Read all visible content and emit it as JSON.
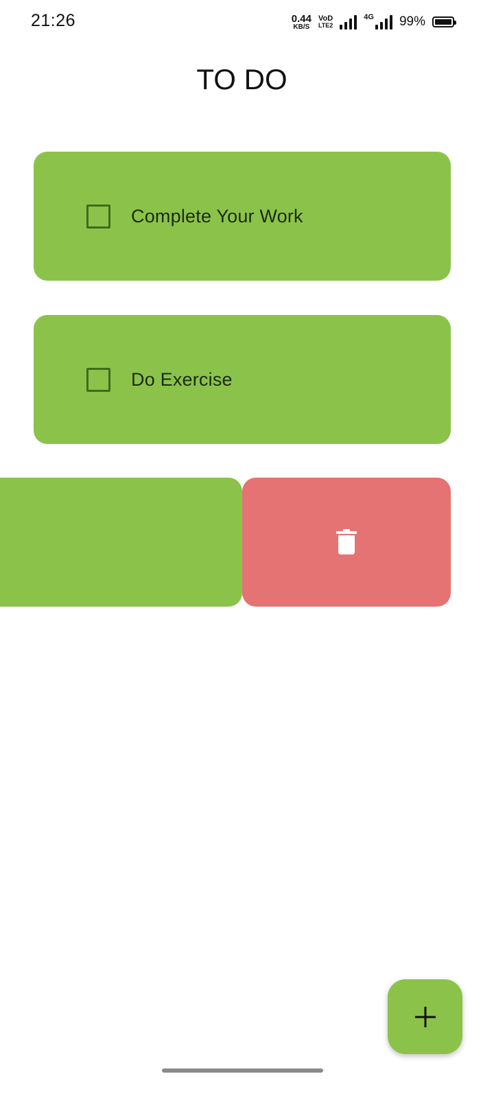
{
  "status_bar": {
    "time": "21:26",
    "net_speed_value": "0.44",
    "net_speed_unit": "KB/S",
    "volte_top": "VoD",
    "volte_bottom": "LTE2",
    "network_type": "4G",
    "battery_percent": "99%",
    "battery_level": 0.99
  },
  "header": {
    "title": "TO DO"
  },
  "todos": [
    {
      "label": "Complete Your Work",
      "checked": false
    },
    {
      "label": "Do Exercise",
      "checked": false
    }
  ],
  "swiped_item": {
    "action_icon": "trash-icon",
    "action_color": "#e57373"
  },
  "fab": {
    "icon": "plus-icon"
  },
  "colors": {
    "card": "#8bc34a",
    "checkbox_border": "#3f6a1c",
    "delete": "#e57373"
  }
}
